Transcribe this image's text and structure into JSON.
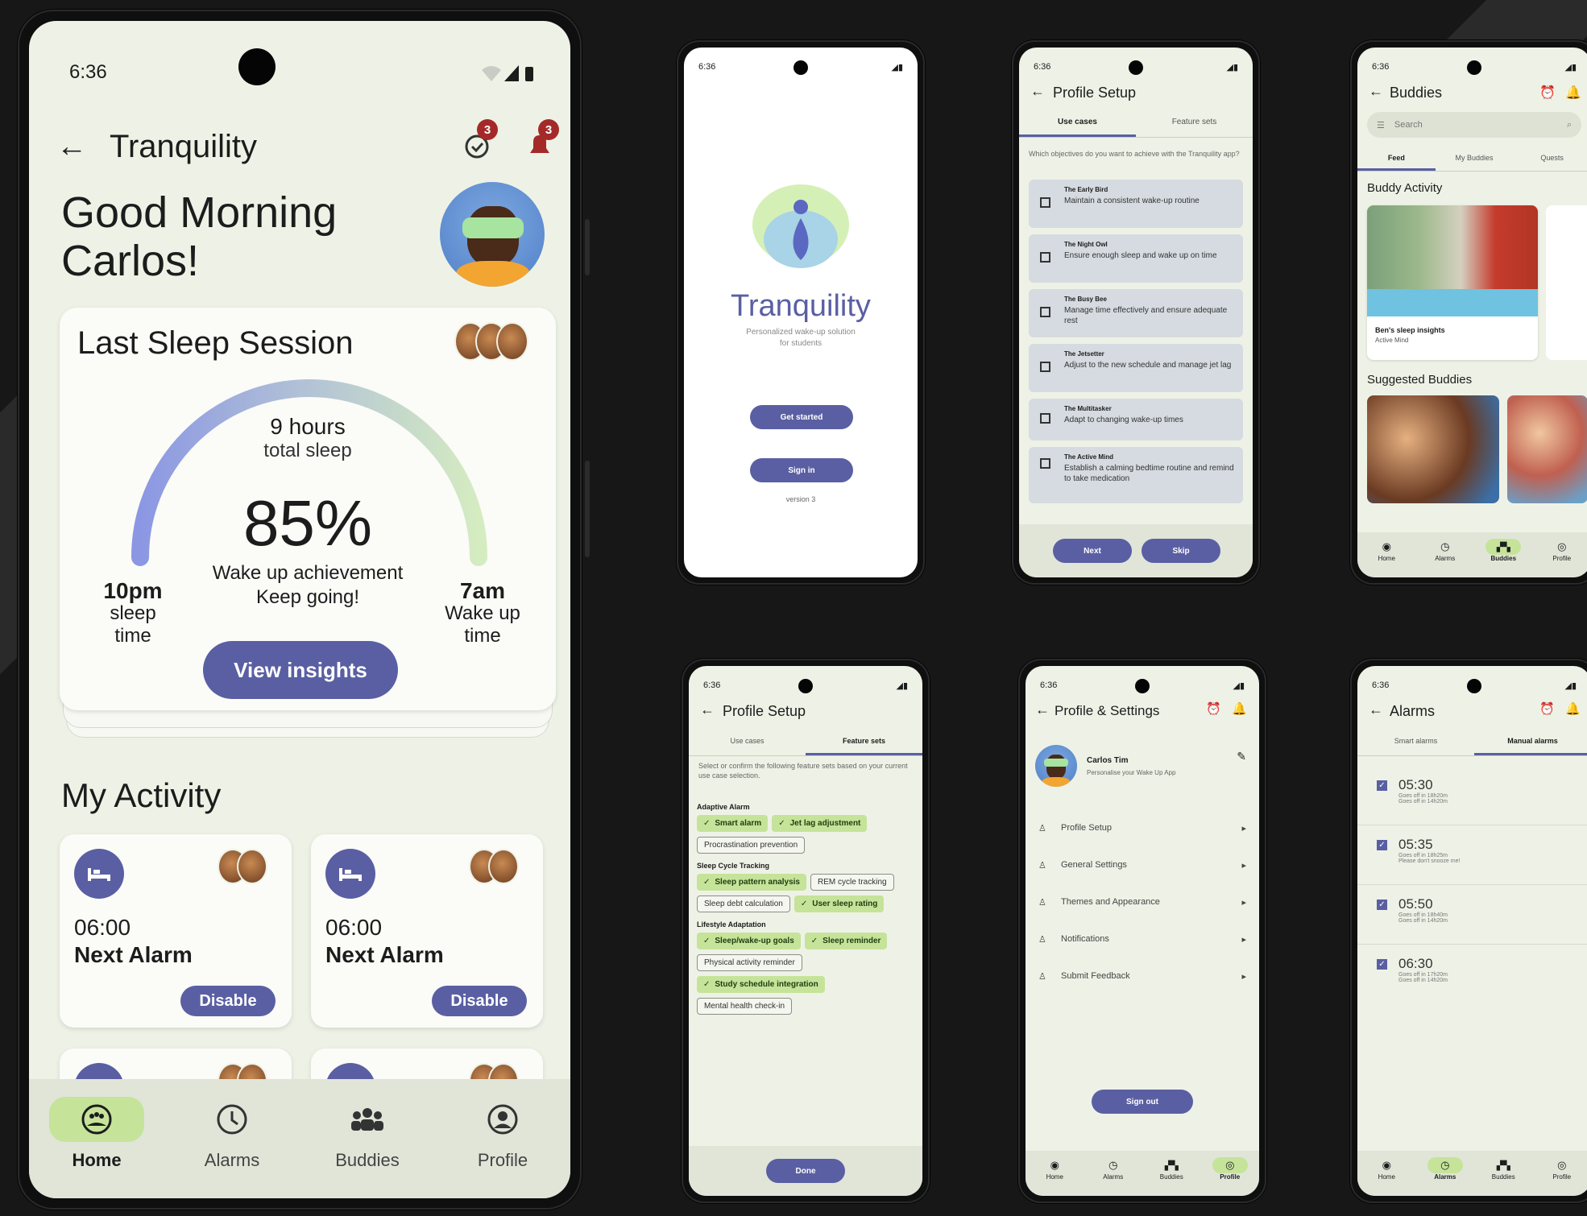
{
  "main_phone": {
    "status_time": "6:36",
    "app_title": "Tranquility",
    "alarm_badge": "3",
    "notification_badge": "3",
    "greeting_line1": "Good Morning",
    "greeting_line2": "Carlos!",
    "sleep_card": {
      "title": "Last Sleep Session",
      "total_value": "9 hours",
      "total_label": "total sleep",
      "percent": "85%",
      "achievement_label": "Wake up achievement",
      "encouragement": "Keep going!",
      "sleep_time_value": "10pm",
      "sleep_time_label1": "sleep",
      "sleep_time_label2": "time",
      "wake_time_value": "7am",
      "wake_time_label1": "Wake up",
      "wake_time_label2": "time",
      "insights_button": "View insights",
      "achievement_fraction": 0.85
    },
    "activity_title": "My Activity",
    "activity_cards": [
      {
        "time": "06:00",
        "label": "Next Alarm",
        "button": "Disable"
      },
      {
        "time": "06:00",
        "label": "Next Alarm",
        "button": "Disable"
      }
    ],
    "nav": [
      "Home",
      "Alarms",
      "Buddies",
      "Profile"
    ]
  },
  "splash": {
    "status_time": "6:36",
    "logo_word": "Tranquility",
    "tagline_line1": "Personalized wake-up solution",
    "tagline_line2": "for students",
    "get_started": "Get started",
    "sign_in": "Sign in",
    "version": "version 3"
  },
  "setup_usecases": {
    "status_time": "6:36",
    "title": "Profile Setup",
    "tabs": [
      "Use cases",
      "Feature sets"
    ],
    "prompt": "Which objectives do you want to achieve with the Tranquility app?",
    "items": [
      {
        "name": "The Early Bird",
        "desc": "Maintain a consistent wake-up routine"
      },
      {
        "name": "The Night Owl",
        "desc": "Ensure enough sleep and wake up on time"
      },
      {
        "name": "The Busy Bee",
        "desc": "Manage time effectively and ensure adequate rest"
      },
      {
        "name": "The Jetsetter",
        "desc": "Adjust to the new schedule and manage jet lag"
      },
      {
        "name": "The Multitasker",
        "desc": "Adapt to changing wake-up times"
      },
      {
        "name": "The Active Mind",
        "desc": "Establish a calming bedtime routine and remind to take medication"
      }
    ],
    "next": "Next",
    "skip": "Skip"
  },
  "buddies": {
    "status_time": "6:36",
    "title": "Buddies",
    "search_placeholder": "Search",
    "tabs": [
      "Feed",
      "My Buddies",
      "Quests"
    ],
    "activity_heading": "Buddy Activity",
    "post_title": "Ben's sleep insights",
    "post_sub": "Active Mind",
    "suggested_heading": "Suggested Buddies",
    "nav": [
      "Home",
      "Alarms",
      "Buddies",
      "Profile"
    ]
  },
  "setup_features": {
    "status_time": "6:36",
    "title": "Profile Setup",
    "tabs": [
      "Use cases",
      "Feature sets"
    ],
    "prompt": "Select or confirm the following feature sets based on your current use case selection.",
    "groups": [
      {
        "heading": "Adaptive Alarm",
        "chips": [
          {
            "label": "Smart alarm",
            "on": true
          },
          {
            "label": "Jet lag adjustment",
            "on": true
          },
          {
            "label": "Procrastination prevention",
            "on": false
          }
        ]
      },
      {
        "heading": "Sleep Cycle Tracking",
        "chips": [
          {
            "label": "Sleep pattern analysis",
            "on": true
          },
          {
            "label": "REM cycle tracking",
            "on": false
          },
          {
            "label": "Sleep debt calculation",
            "on": false
          },
          {
            "label": "User sleep rating",
            "on": true
          }
        ]
      },
      {
        "heading": "Lifestyle Adaptation",
        "chips": [
          {
            "label": "Sleep/wake-up goals",
            "on": true
          },
          {
            "label": "Sleep reminder",
            "on": true
          },
          {
            "label": "Physical activity reminder",
            "on": false
          },
          {
            "label": "Study schedule integration",
            "on": true
          },
          {
            "label": "Mental health check-in",
            "on": false
          }
        ]
      }
    ],
    "done": "Done"
  },
  "settings": {
    "status_time": "6:36",
    "title": "Profile & Settings",
    "user_name": "Carlos Tim",
    "user_sub": "Personalise your Wake Up App",
    "items": [
      "Profile Setup",
      "General Settings",
      "Themes and Appearance",
      "Notifications",
      "Submit Feedback"
    ],
    "sign_out": "Sign out",
    "nav": [
      "Home",
      "Alarms",
      "Buddies",
      "Profile"
    ]
  },
  "alarms": {
    "status_time": "6:36",
    "title": "Alarms",
    "tabs": [
      "Smart alarms",
      "Manual alarms"
    ],
    "items": [
      {
        "time": "05:30",
        "line1": "Goes off in 18h20m",
        "line2": "Goes off in 14h20m"
      },
      {
        "time": "05:35",
        "line1": "Goes off in 18h25m",
        "line2": "Please don't snooze me!"
      },
      {
        "time": "05:50",
        "line1": "Goes off in 18h40m",
        "line2": "Goes off in 14h20m"
      },
      {
        "time": "06:30",
        "line1": "Goes off in 17h20m",
        "line2": "Goes off in 14h20m"
      }
    ],
    "nav": [
      "Home",
      "Alarms",
      "Buddies",
      "Profile"
    ]
  },
  "colors": {
    "accent": "#5a5fa3",
    "chip_on": "#c6e39a",
    "screen_bg": "#eef2e6",
    "badge": "#a42a2a"
  }
}
